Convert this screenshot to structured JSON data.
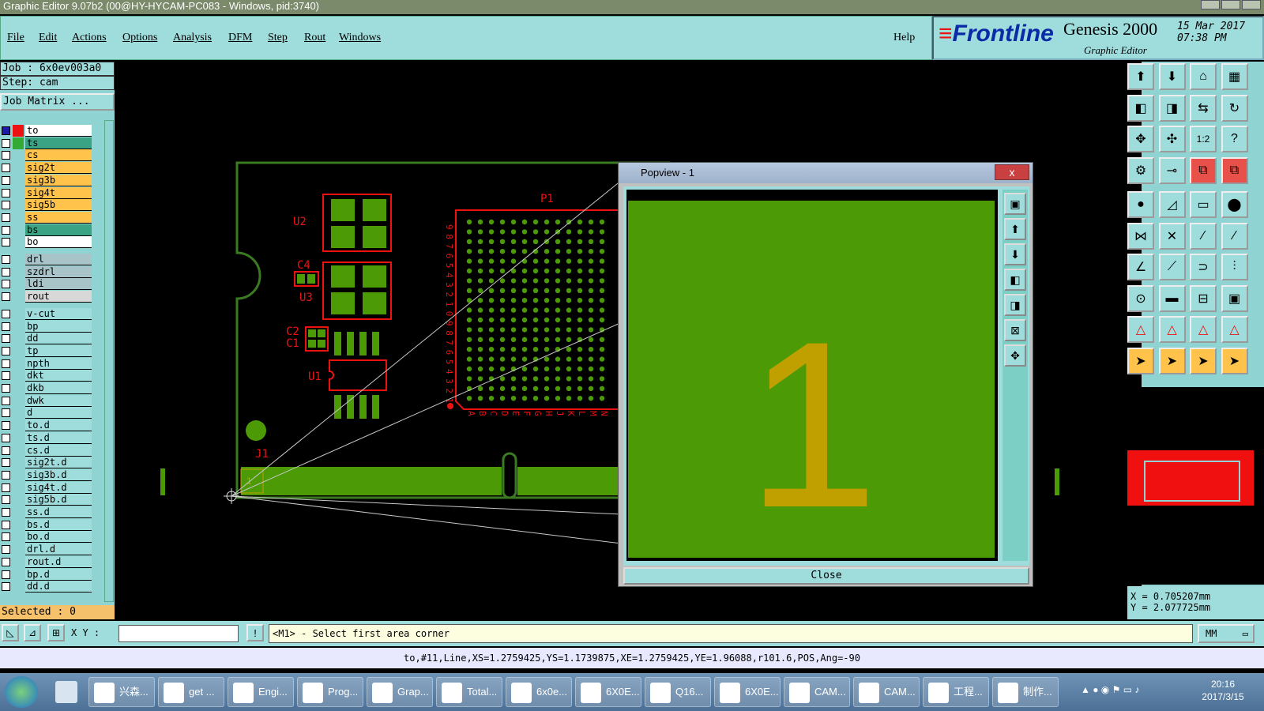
{
  "window": {
    "title": "Graphic Editor 9.07b2 (00@HY-HYCAM-PC083 - Windows, pid:3740)"
  },
  "menu": {
    "items": [
      "File",
      "Edit",
      "Actions",
      "Options",
      "Analysis",
      "DFM",
      "Step",
      "Rout",
      "Windows"
    ],
    "help": "Help"
  },
  "brand": {
    "logo": "Frontline",
    "product": "Genesis 2000",
    "subtitle": "Graphic Editor",
    "date": "15 Mar 2017",
    "time": "07:38 PM"
  },
  "job": {
    "job_label": "Job : 6x0ev003a0",
    "step_label": "Step: cam",
    "matrix_button": "Job Matrix ..."
  },
  "layers": [
    {
      "name": "to",
      "color": "#ffffff",
      "sw": "#e11"
    },
    {
      "name": "ts",
      "color": "#3aa383",
      "sw": "#33aa33"
    },
    {
      "name": "cs",
      "color": "#ffc24a",
      "sw": ""
    },
    {
      "name": "sig2t",
      "color": "#ffc24a",
      "sw": ""
    },
    {
      "name": "sig3b",
      "color": "#ffc24a",
      "sw": ""
    },
    {
      "name": "sig4t",
      "color": "#ffc24a",
      "sw": ""
    },
    {
      "name": "sig5b",
      "color": "#ffc24a",
      "sw": ""
    },
    {
      "name": "ss",
      "color": "#ffc24a",
      "sw": ""
    },
    {
      "name": "bs",
      "color": "#3aa383",
      "sw": ""
    },
    {
      "name": "bo",
      "color": "#ffffff",
      "sw": ""
    },
    {
      "name": "drl",
      "color": "#a8c4c8",
      "sw": ""
    },
    {
      "name": "szdrl",
      "color": "#a8c4c8",
      "sw": ""
    },
    {
      "name": "ldi",
      "color": "#a8c4c8",
      "sw": ""
    },
    {
      "name": "rout",
      "color": "#d8d8d8",
      "sw": ""
    },
    {
      "name": "v-cut",
      "color": "#9fdcdc",
      "sw": ""
    },
    {
      "name": "bp",
      "color": "#9fdcdc",
      "sw": ""
    },
    {
      "name": "dd",
      "color": "#9fdcdc",
      "sw": ""
    },
    {
      "name": "tp",
      "color": "#9fdcdc",
      "sw": ""
    },
    {
      "name": "npth",
      "color": "#9fdcdc",
      "sw": ""
    },
    {
      "name": "dkt",
      "color": "#9fdcdc",
      "sw": ""
    },
    {
      "name": "dkb",
      "color": "#9fdcdc",
      "sw": ""
    },
    {
      "name": "dwk",
      "color": "#9fdcdc",
      "sw": ""
    },
    {
      "name": "d",
      "color": "#9fdcdc",
      "sw": ""
    },
    {
      "name": "to.d",
      "color": "#9fdcdc",
      "sw": ""
    },
    {
      "name": "ts.d",
      "color": "#9fdcdc",
      "sw": ""
    },
    {
      "name": "cs.d",
      "color": "#9fdcdc",
      "sw": ""
    },
    {
      "name": "sig2t.d",
      "color": "#9fdcdc",
      "sw": ""
    },
    {
      "name": "sig3b.d",
      "color": "#9fdcdc",
      "sw": ""
    },
    {
      "name": "sig4t.d",
      "color": "#9fdcdc",
      "sw": ""
    },
    {
      "name": "sig5b.d",
      "color": "#9fdcdc",
      "sw": ""
    },
    {
      "name": "ss.d",
      "color": "#9fdcdc",
      "sw": ""
    },
    {
      "name": "bs.d",
      "color": "#9fdcdc",
      "sw": ""
    },
    {
      "name": "bo.d",
      "color": "#9fdcdc",
      "sw": ""
    },
    {
      "name": "drl.d",
      "color": "#9fdcdc",
      "sw": ""
    },
    {
      "name": "rout.d",
      "color": "#9fdcdc",
      "sw": ""
    },
    {
      "name": "bp.d",
      "color": "#9fdcdc",
      "sw": ""
    },
    {
      "name": "dd.d",
      "color": "#9fdcdc",
      "sw": ""
    }
  ],
  "selected": "Selected : 0",
  "pcb": {
    "labels": [
      "U2",
      "C4",
      "U3",
      "C2",
      "C1",
      "U1",
      "P1",
      "J1"
    ],
    "bga_rows": [
      "9",
      "8",
      "7",
      "6",
      "5",
      "4",
      "3",
      "2",
      "1",
      "0",
      "9",
      "8",
      "7",
      "6",
      "5",
      "4",
      "3",
      "2",
      "1"
    ],
    "bga_cols": [
      "A",
      "B",
      "C",
      "D",
      "E",
      "F",
      "G",
      "H",
      "J",
      "K",
      "L",
      "M",
      "N"
    ],
    "pad_mark": "1"
  },
  "popview": {
    "title": "Popview - 1",
    "close_x": "x",
    "value": "1",
    "close_button": "Close"
  },
  "coords": {
    "x": "X = 0.705207mm",
    "y": "Y = 2.077725mm"
  },
  "status": {
    "xy_label": "X Y :",
    "message": "<M1> - Select first area corner",
    "units": "MM",
    "info": "to,#11,Line,XS=1.2759425,YS=1.1739875,XE=1.2759425,YE=1.96088,r101.6,POS,Ang=-90"
  },
  "toolbar_icons": [
    "window-up-icon",
    "window-down-icon",
    "home-icon",
    "panel-icon",
    "left-icon",
    "right-icon",
    "mirror-icon",
    "refresh-icon",
    "fit-icon",
    "center-icon",
    "zoom-1to2-icon",
    "help-icon",
    "tool-icon",
    "pin-icon",
    "layers-icon",
    "layers-alt-icon",
    "pad-icon",
    "no-pad-icon",
    "ruler-icon",
    "dot-icon",
    "net-icon",
    "cross-icon",
    "line-icon",
    "line-alt-icon",
    "pen-red-icon",
    "pen-blue-icon",
    "arc-icon",
    "snap-icon",
    "points-icon",
    "minus-icon",
    "measure-icon",
    "cube-icon",
    "tri-a-icon",
    "tri-b-icon",
    "tri-c-icon",
    "tri-d-icon",
    "pointer-icon",
    "pointer-box-icon",
    "pointer-circle-icon",
    "pointer-route-icon"
  ],
  "taskbar": {
    "items": [
      "兴森...",
      "get ...",
      "Engi...",
      "Prog...",
      "Grap...",
      "Total...",
      "6x0e...",
      "6X0E...",
      "Q16...",
      "6X0E...",
      "CAM...",
      "CAM...",
      "工程...",
      "制作..."
    ],
    "time": "20:16",
    "date": "2017/3/15"
  },
  "colors": {
    "panel": "#9fdcdc",
    "copper": "#4c9a06",
    "outline": "#e11111",
    "silk": "#c0a000"
  }
}
